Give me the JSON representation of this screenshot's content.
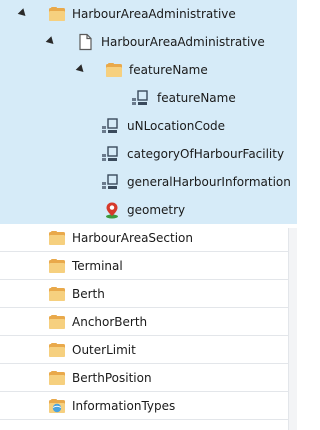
{
  "tree": {
    "root_label": "HarbourAreaAdministrative",
    "feature_label": "HarbourAreaAdministrative",
    "feature_name_group_label": "featureName",
    "feature_name_attr_label": "featureName",
    "attributes": [
      "uNLocationCode",
      "categoryOfHarbourFacility",
      "generalHarbourInformation"
    ],
    "geometry_label": "geometry",
    "sibling_folders": [
      "HarbourAreaSection",
      "Terminal",
      "Berth",
      "AnchorBerth",
      "OuterLimit",
      "BerthPosition"
    ],
    "information_types_label": "InformationTypes"
  },
  "colors": {
    "selected_bg": "#d6ebf8",
    "folder": "#f2c46a",
    "attribute_icon": "#6a7a8c",
    "geometry_pin": "#d6392b",
    "info_folder": "#4aa3df"
  }
}
